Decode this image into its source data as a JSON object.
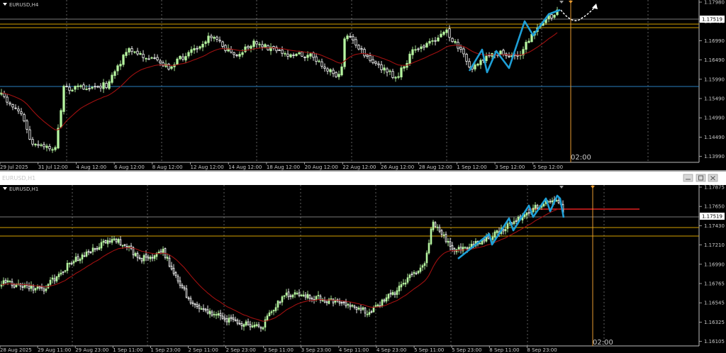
{
  "colors": {
    "background": "#000000",
    "bull_candle": "#b6f5a0",
    "bear_candle": "#ffffff",
    "moving_average": "#a01010",
    "zigzag": "#1e9fd6",
    "gold_level": "#d4a000",
    "gray_level": "#a0a0a0",
    "blue_level": "#2a7fbf",
    "red_level": "#e02020",
    "vline": "#e89a30",
    "price_tag_bg": "#ffffff"
  },
  "top_chart": {
    "title": "EURUSD,H4",
    "current_price": "1.17519",
    "price_labels": [
      "1.17980",
      "1.17480",
      "1.16990",
      "1.16490",
      "1.15990",
      "1.15490",
      "1.14990",
      "1.14490",
      "1.13990"
    ],
    "time_labels": [
      "29 Jul 2025",
      "31 Jul 12:00",
      "4 Aug 12:00",
      "6 Aug 12:00",
      "8 Aug 12:00",
      "12 Aug 12:00",
      "14 Aug 12:00",
      "18 Aug 12:00",
      "20 Aug 12:00",
      "22 Aug 12:00",
      "26 Aug 12:00",
      "28 Aug 12:00",
      "1 Sep 12:00",
      "3 Sep 12:00",
      "5 Sep 12:00"
    ],
    "cursor_time": "02:00",
    "arrow_icon": "curved-arrow-projection"
  },
  "bottom_chart": {
    "title": "EURUSD,H1",
    "current_price": "1.17519",
    "price_labels": [
      "1.17875",
      "1.17650",
      "1.17430",
      "1.17210",
      "1.16990",
      "1.16765",
      "1.16545",
      "1.16325",
      "1.16105"
    ],
    "time_labels": [
      "28 Aug 2025",
      "29 Aug 11:00",
      "29 Aug 23:00",
      "1 Sep 11:00",
      "1 Sep 23:00",
      "2 Sep 11:00",
      "2 Sep 23:00",
      "3 Sep 11:00",
      "3 Sep 23:00",
      "4 Sep 11:00",
      "4 Sep 23:00",
      "5 Sep 11:00",
      "5 Sep 23:00",
      "8 Sep 11:00",
      "8 Sep 23:00"
    ],
    "cursor_time": "02:00"
  },
  "window_buttons": [
    "minimize-icon",
    "restore-icon",
    "close-icon"
  ]
}
